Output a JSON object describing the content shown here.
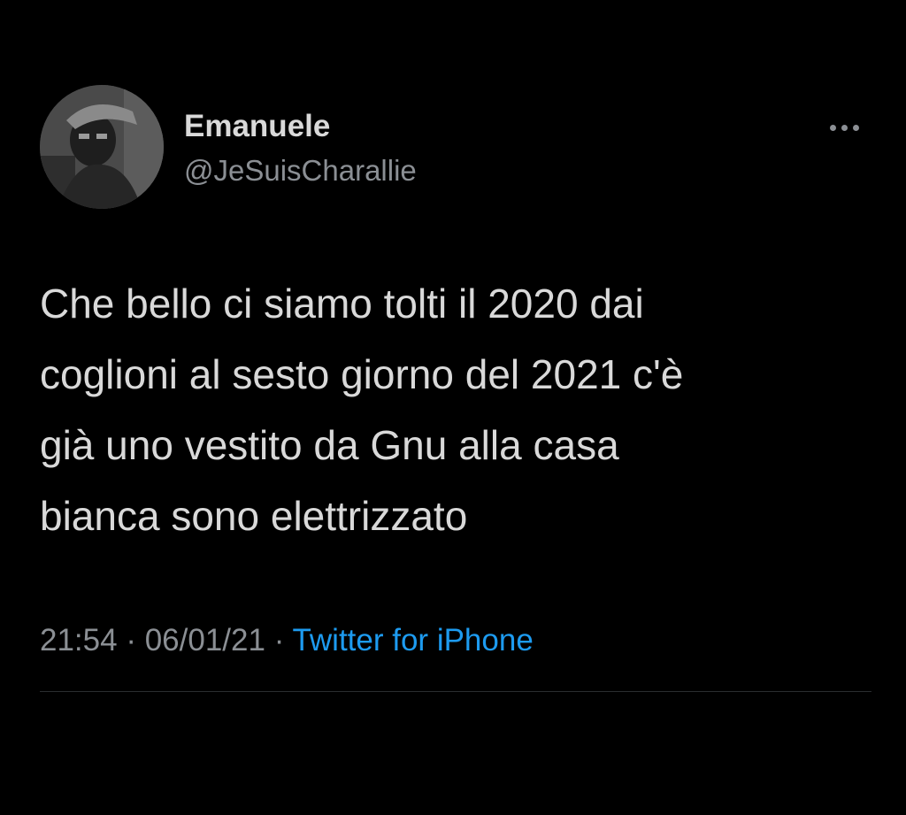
{
  "tweet": {
    "author": {
      "display_name": "Emanuele",
      "handle": "@JeSuisCharallie",
      "avatar_icon": "profile-photo"
    },
    "more_icon": "more-dots-icon",
    "text": "Che bello ci siamo tolti il 2020 dai\ncoglioni al sesto giorno del 2021 c'è\ngià uno vestito da Gnu alla casa\nbianca sono elettrizzato",
    "time": "21:54",
    "separator": "·",
    "date": "06/01/21",
    "source": "Twitter for iPhone"
  },
  "colors": {
    "background": "#000000",
    "primary_text": "#d9d9d9",
    "secondary_text": "#8b8f94",
    "link": "#1d9bf0"
  }
}
